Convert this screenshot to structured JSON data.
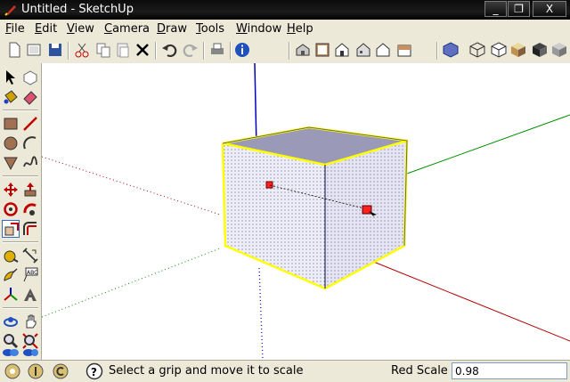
{
  "window": {
    "title": "Untitled - SketchUp",
    "minimize_label": "_",
    "restore_label": "❐",
    "close_label": "X"
  },
  "menu": [
    {
      "label": "File",
      "mnemonic": "F"
    },
    {
      "label": "Edit",
      "mnemonic": "E"
    },
    {
      "label": "View",
      "mnemonic": "V"
    },
    {
      "label": "Camera",
      "mnemonic": "C"
    },
    {
      "label": "Draw",
      "mnemonic": "D"
    },
    {
      "label": "Tools",
      "mnemonic": "T"
    },
    {
      "label": "Window",
      "mnemonic": "W"
    },
    {
      "label": "Help",
      "mnemonic": "H"
    }
  ],
  "toolbar_icons": [
    "new-icon",
    "open-icon",
    "save-icon",
    "cut-icon",
    "copy-icon",
    "paste-icon",
    "erase-icon",
    "undo-icon",
    "redo-icon",
    "print-icon",
    "model-info-icon",
    "iso-view-icon",
    "top-view-icon",
    "front-view-icon",
    "right-view-icon",
    "back-view-icon",
    "left-view-icon",
    "xray-icon",
    "wireframe-icon",
    "hidden-line-icon",
    "shaded-icon",
    "shaded-textures-icon",
    "monochrome-icon"
  ],
  "left_toolbar_icons": [
    "select-icon",
    "component-icon",
    "paint-bucket-icon",
    "eraser-icon",
    "rectangle-icon",
    "line-icon",
    "circle-icon",
    "arc-icon",
    "polygon-icon",
    "freehand-icon",
    "move-icon",
    "push-pull-icon",
    "rotate-icon",
    "follow-me-icon",
    "scale-icon",
    "offset-icon",
    "tape-measure-icon",
    "dimension-icon",
    "protractor-icon",
    "text-icon",
    "axes-icon",
    "3d-text-icon",
    "orbit-icon",
    "pan-icon",
    "zoom-icon",
    "zoom-extents-icon",
    "zoom-window-icon",
    "previous-view-icon"
  ],
  "status": {
    "text": "Select a grip and move it to scale the c",
    "measure_label": "Red Scale",
    "measure_value": "0.98"
  },
  "colors": {
    "red_axis": "#b00000",
    "green_axis": "#009000",
    "blue_axis": "#0000c0",
    "selection": "#ffff00",
    "face_front": "#e8e8f4",
    "face_top": "#9898b8"
  }
}
